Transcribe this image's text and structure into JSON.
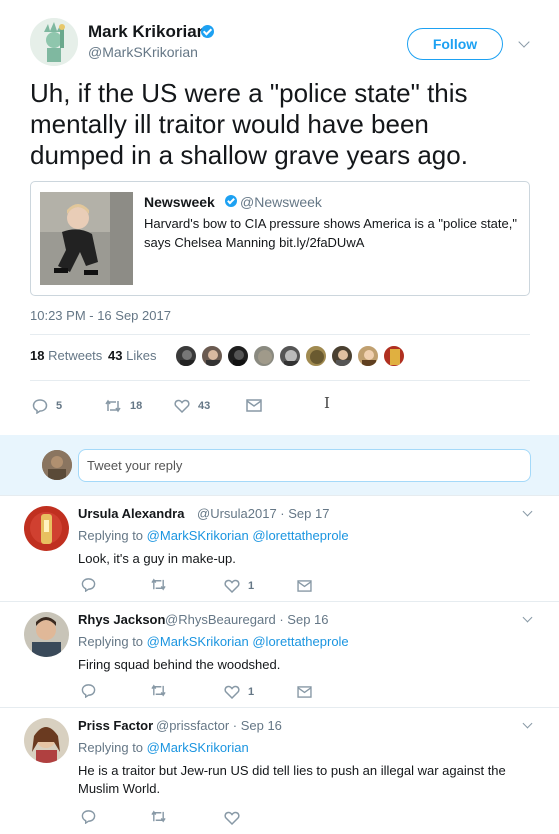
{
  "author": {
    "name": "Mark Krikorian",
    "handle": "@MarkSKrikorian"
  },
  "follow_label": "Follow",
  "tweet_text": "Uh, if the US were a \"police state\" this mentally ill traitor would have been dumped in a shallow grave years ago.",
  "quoted": {
    "name": "Newsweek",
    "handle": "@Newsweek",
    "text": "Harvard's bow to CIA pressure shows America is a \"police state,\" says Chelsea Manning bit.ly/2faDUwA"
  },
  "timestamp": "10:23 PM - 16 Sep 2017",
  "stats": {
    "retweets_count": "18",
    "retweets_label": "Retweets",
    "likes_count": "43",
    "likes_label": "Likes"
  },
  "actions": {
    "replies": "5",
    "retweets": "18",
    "likes": "43"
  },
  "reply_box": {
    "placeholder": "Tweet your reply"
  },
  "replies": [
    {
      "name": "Ursula Alexandra",
      "meta": "@Ursula2017 · Sep 17",
      "replying_prefix": "Replying to",
      "mentions": [
        "@MarkSKrikorian",
        "@lorettatheprole"
      ],
      "text": "Look, it's a guy in make-up.",
      "likes": "1"
    },
    {
      "name": "Rhys Jackson",
      "meta": "@RhysBeauregard · Sep 16",
      "replying_prefix": "Replying to",
      "mentions": [
        "@MarkSKrikorian",
        "@lorettatheprole"
      ],
      "text": "Firing squad behind the woodshed.",
      "likes": "1"
    },
    {
      "name": "Priss Factor",
      "meta": "@prissfactor · Sep 16",
      "replying_prefix": "Replying to",
      "mentions": [
        "@MarkSKrikorian"
      ],
      "text": "He is a traitor but Jew-run US did tell lies to push an illegal war against the Muslim World.",
      "likes": ""
    }
  ],
  "colors": {
    "accent": "#1da1f2",
    "link": "#1b95e0",
    "secondary_text": "#657786",
    "reply_bar_bg": "#e8f5fd",
    "icon_gray": "#8899a6"
  },
  "icons": [
    "verified-badge-icon",
    "chevron-down-icon",
    "reply-icon",
    "retweet-icon",
    "like-icon",
    "message-icon"
  ]
}
